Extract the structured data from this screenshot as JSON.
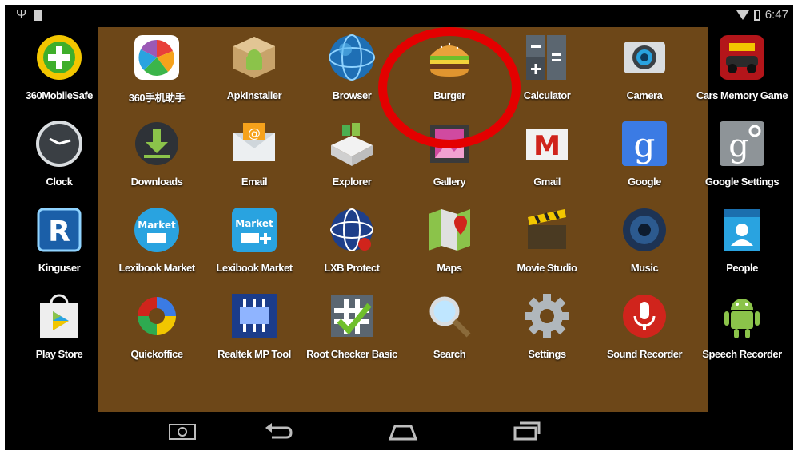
{
  "status": {
    "time": "6:47"
  },
  "apps": [
    {
      "label": "360MobileSafe"
    },
    {
      "label": "360手机助手"
    },
    {
      "label": "ApkInstaller"
    },
    {
      "label": "Browser"
    },
    {
      "label": "Burger"
    },
    {
      "label": "Calculator"
    },
    {
      "label": "Camera"
    },
    {
      "label": "Cars Memory Game"
    },
    {
      "label": "Clock"
    },
    {
      "label": "Downloads"
    },
    {
      "label": "Email"
    },
    {
      "label": "Explorer"
    },
    {
      "label": "Gallery"
    },
    {
      "label": "Gmail"
    },
    {
      "label": "Google"
    },
    {
      "label": "Google Settings"
    },
    {
      "label": "Kinguser"
    },
    {
      "label": "Lexibook Market"
    },
    {
      "label": "Lexibook Market"
    },
    {
      "label": "LXB Protect"
    },
    {
      "label": "Maps"
    },
    {
      "label": "Movie Studio"
    },
    {
      "label": "Music"
    },
    {
      "label": "People"
    },
    {
      "label": "Play Store"
    },
    {
      "label": "Quickoffice"
    },
    {
      "label": "Realtek MP Tool"
    },
    {
      "label": "Root Checker Basic"
    },
    {
      "label": "Search"
    },
    {
      "label": "Settings"
    },
    {
      "label": "Sound Recorder"
    },
    {
      "label": "Speech Recorder"
    }
  ],
  "icons": {
    "r_letter": "R",
    "google_g": "g",
    "gmail_m": "M",
    "email_at": "@",
    "settings_g": "g",
    "lexibook_1": "Market",
    "lexibook_2": "Market"
  },
  "annotation": {
    "color": "#e40000"
  },
  "colors": {
    "panel": "#6d4718",
    "background": "#000000"
  }
}
